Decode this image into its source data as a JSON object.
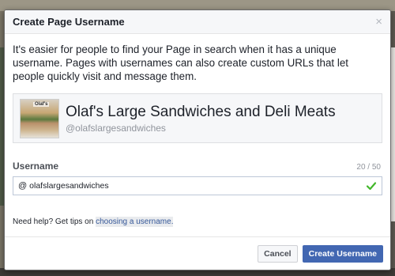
{
  "dialog": {
    "title": "Create Page Username",
    "close_glyph": "×",
    "intro": "It's easier for people to find your Page in search when it has a unique username. Pages with usernames can also create custom URLs that let people quickly visit and message them."
  },
  "page": {
    "thumb_label": "Olaf's",
    "name": "Olaf's Large Sandwiches and Deli Meats",
    "handle": "@olafslargesandwiches"
  },
  "username_field": {
    "label": "Username",
    "char_count": "20 / 50",
    "prefix": "@",
    "value": "olafslargesandwiches",
    "valid": true
  },
  "help": {
    "text": "Need help? Get tips on ",
    "link_text": "choosing a username."
  },
  "footer": {
    "cancel_label": "Cancel",
    "submit_label": "Create Username"
  },
  "colors": {
    "primary": "#4267b2",
    "valid_check": "#42b72a",
    "link": "#365899"
  },
  "icons": {
    "close": "close-icon",
    "check": "check-icon",
    "at": "at-icon"
  }
}
